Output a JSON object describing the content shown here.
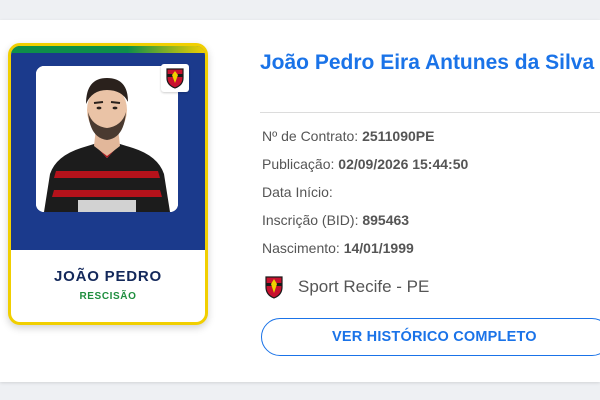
{
  "card": {
    "name": "JOÃO PEDRO",
    "status": "RESCISÃO",
    "photo_icon": "player-photo",
    "badge_icon": "club-crest-icon"
  },
  "player": {
    "full_name": "João Pedro Eira Antunes da Silva"
  },
  "info": {
    "contract_label": "Nº de Contrato: ",
    "contract_value": "2511090PE",
    "publication_label": "Publicação: ",
    "publication_value": "02/09/2026 15:44:50",
    "start_label": "Data Início:",
    "start_value": "",
    "bid_label": "Inscrição (BID): ",
    "bid_value": "895463",
    "birth_label": "Nascimento: ",
    "birth_value": "14/01/1999"
  },
  "club": {
    "name": "Sport Recife - PE",
    "icon": "club-crest-icon"
  },
  "actions": {
    "history_label": "VER HISTÓRICO COMPLETO"
  },
  "colors": {
    "accent": "#1a73e8",
    "card_blue": "#1b3a8c",
    "card_border": "#f1cf00",
    "status_green": "#1e8e3e"
  }
}
